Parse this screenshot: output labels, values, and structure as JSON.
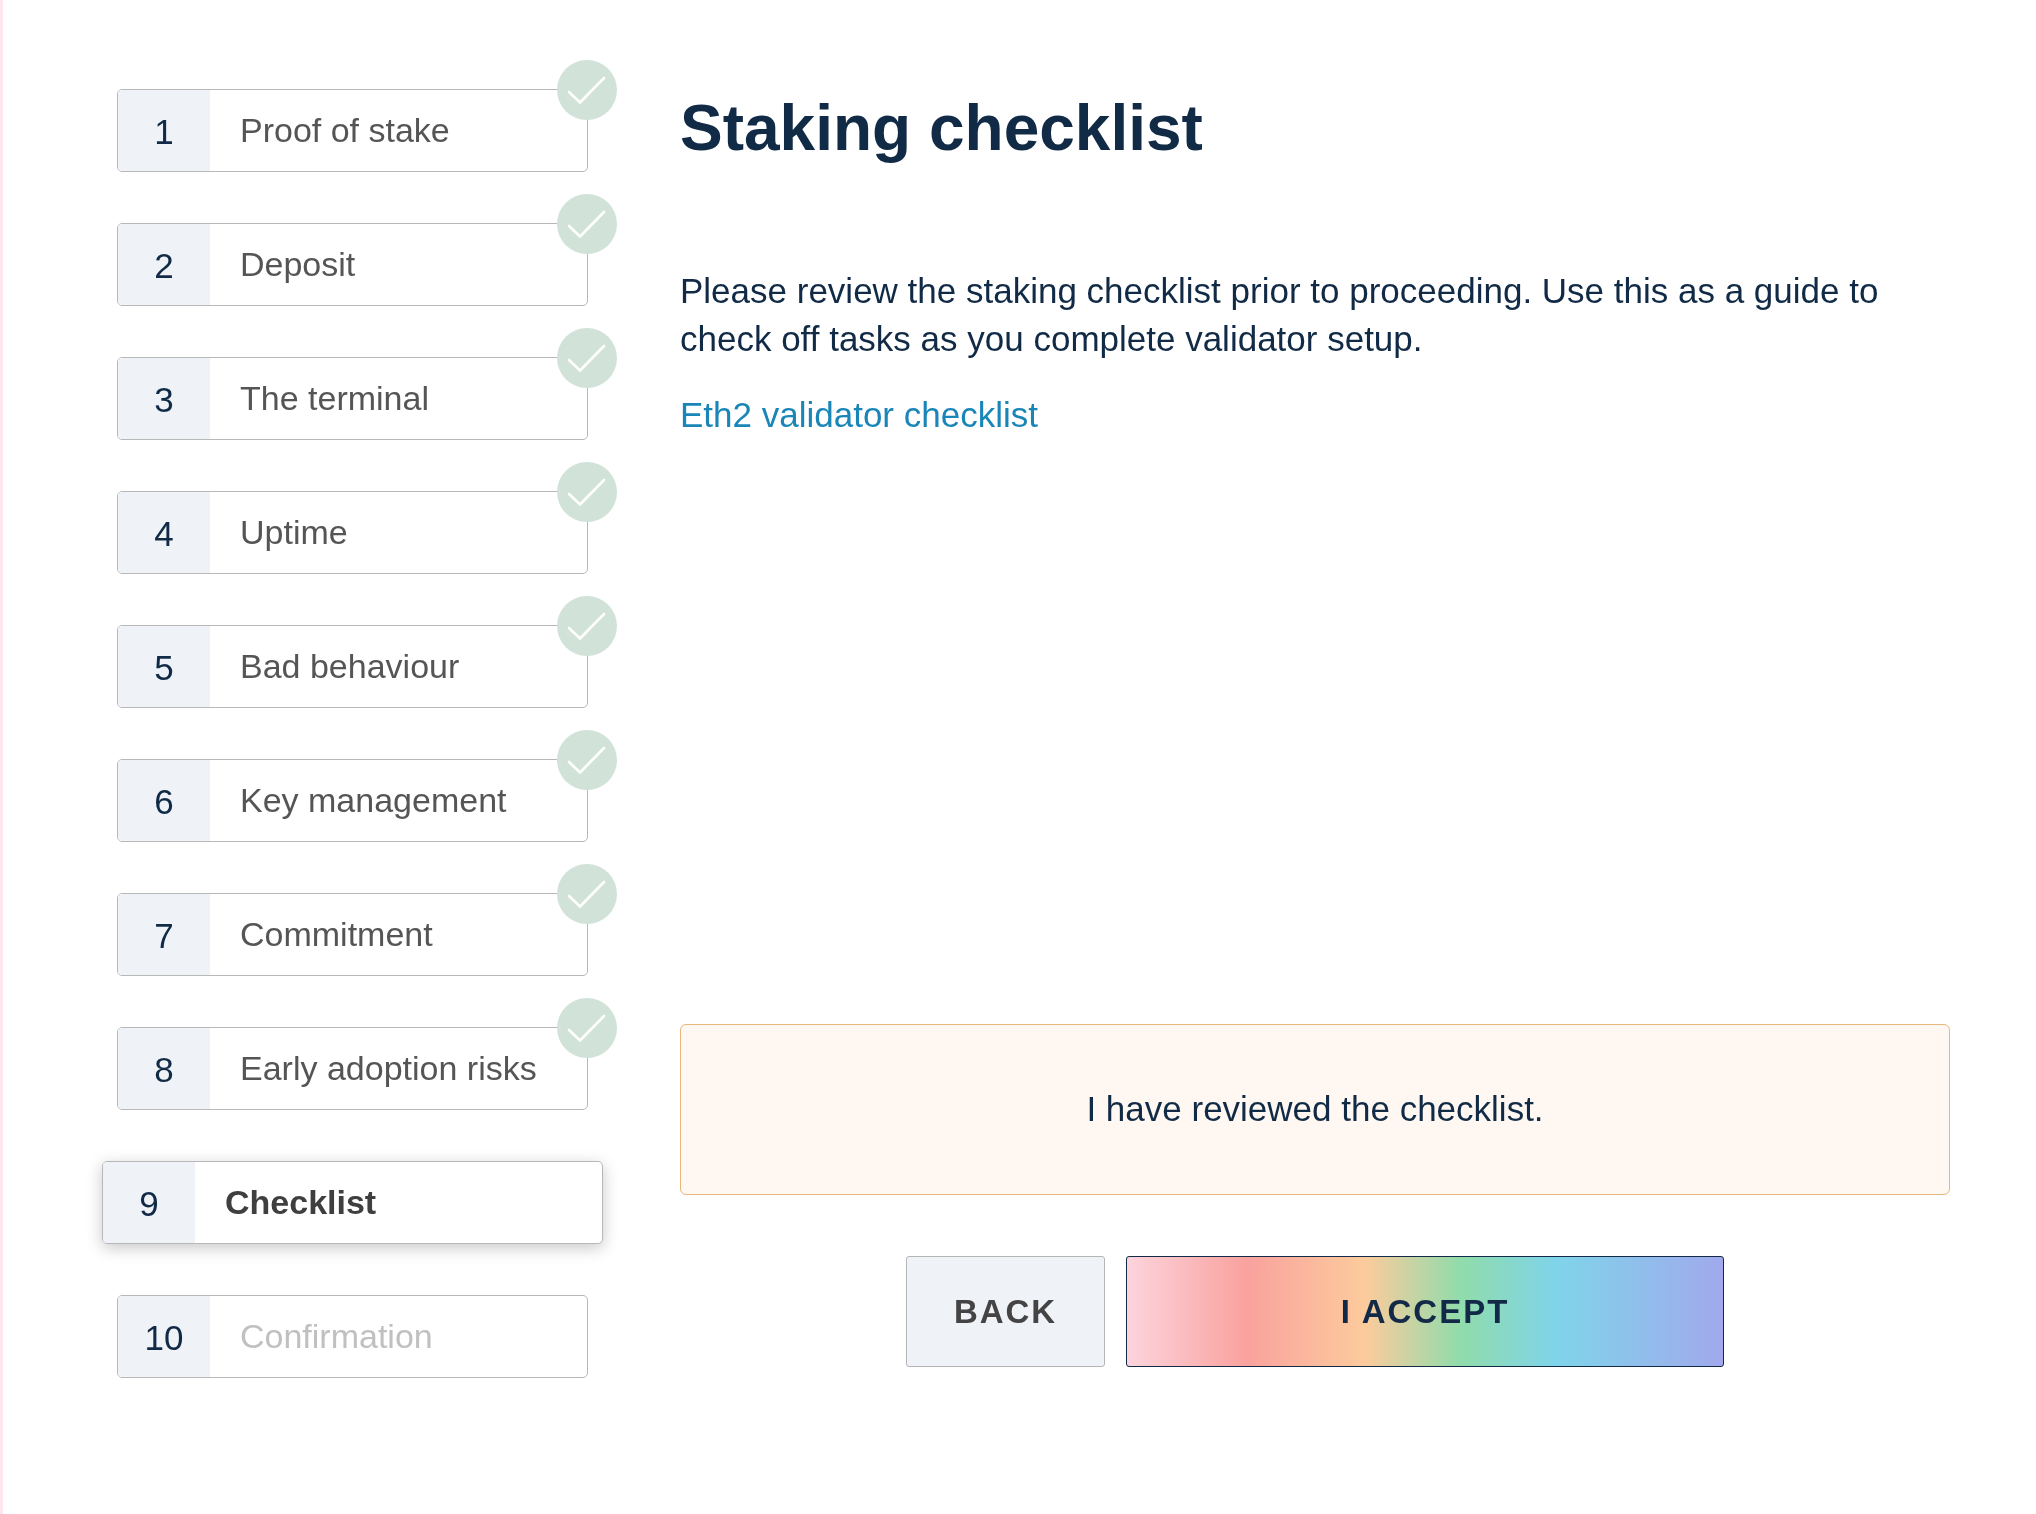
{
  "steps": [
    {
      "number": "1",
      "label": "Proof of stake",
      "completed": true,
      "selected": false,
      "disabled": false
    },
    {
      "number": "2",
      "label": "Deposit",
      "completed": true,
      "selected": false,
      "disabled": false
    },
    {
      "number": "3",
      "label": "The terminal",
      "completed": true,
      "selected": false,
      "disabled": false
    },
    {
      "number": "4",
      "label": "Uptime",
      "completed": true,
      "selected": false,
      "disabled": false
    },
    {
      "number": "5",
      "label": "Bad behaviour",
      "completed": true,
      "selected": false,
      "disabled": false
    },
    {
      "number": "6",
      "label": "Key management",
      "completed": true,
      "selected": false,
      "disabled": false
    },
    {
      "number": "7",
      "label": "Commitment",
      "completed": true,
      "selected": false,
      "disabled": false
    },
    {
      "number": "8",
      "label": "Early adoption risks",
      "completed": true,
      "selected": false,
      "disabled": false
    },
    {
      "number": "9",
      "label": "Checklist",
      "completed": false,
      "selected": true,
      "disabled": false
    },
    {
      "number": "10",
      "label": "Confirmation",
      "completed": false,
      "selected": false,
      "disabled": true
    }
  ],
  "content": {
    "title": "Staking checklist",
    "description": "Please review the staking checklist prior to proceeding. Use this as a guide to check off tasks as you complete validator setup.",
    "link": "Eth2 validator checklist"
  },
  "acknowledgement": {
    "label": "I have reviewed the checklist."
  },
  "buttons": [
    {
      "kind": "secondary",
      "label": "BACK"
    },
    {
      "kind": "primary",
      "label": "I ACCEPT"
    }
  ]
}
